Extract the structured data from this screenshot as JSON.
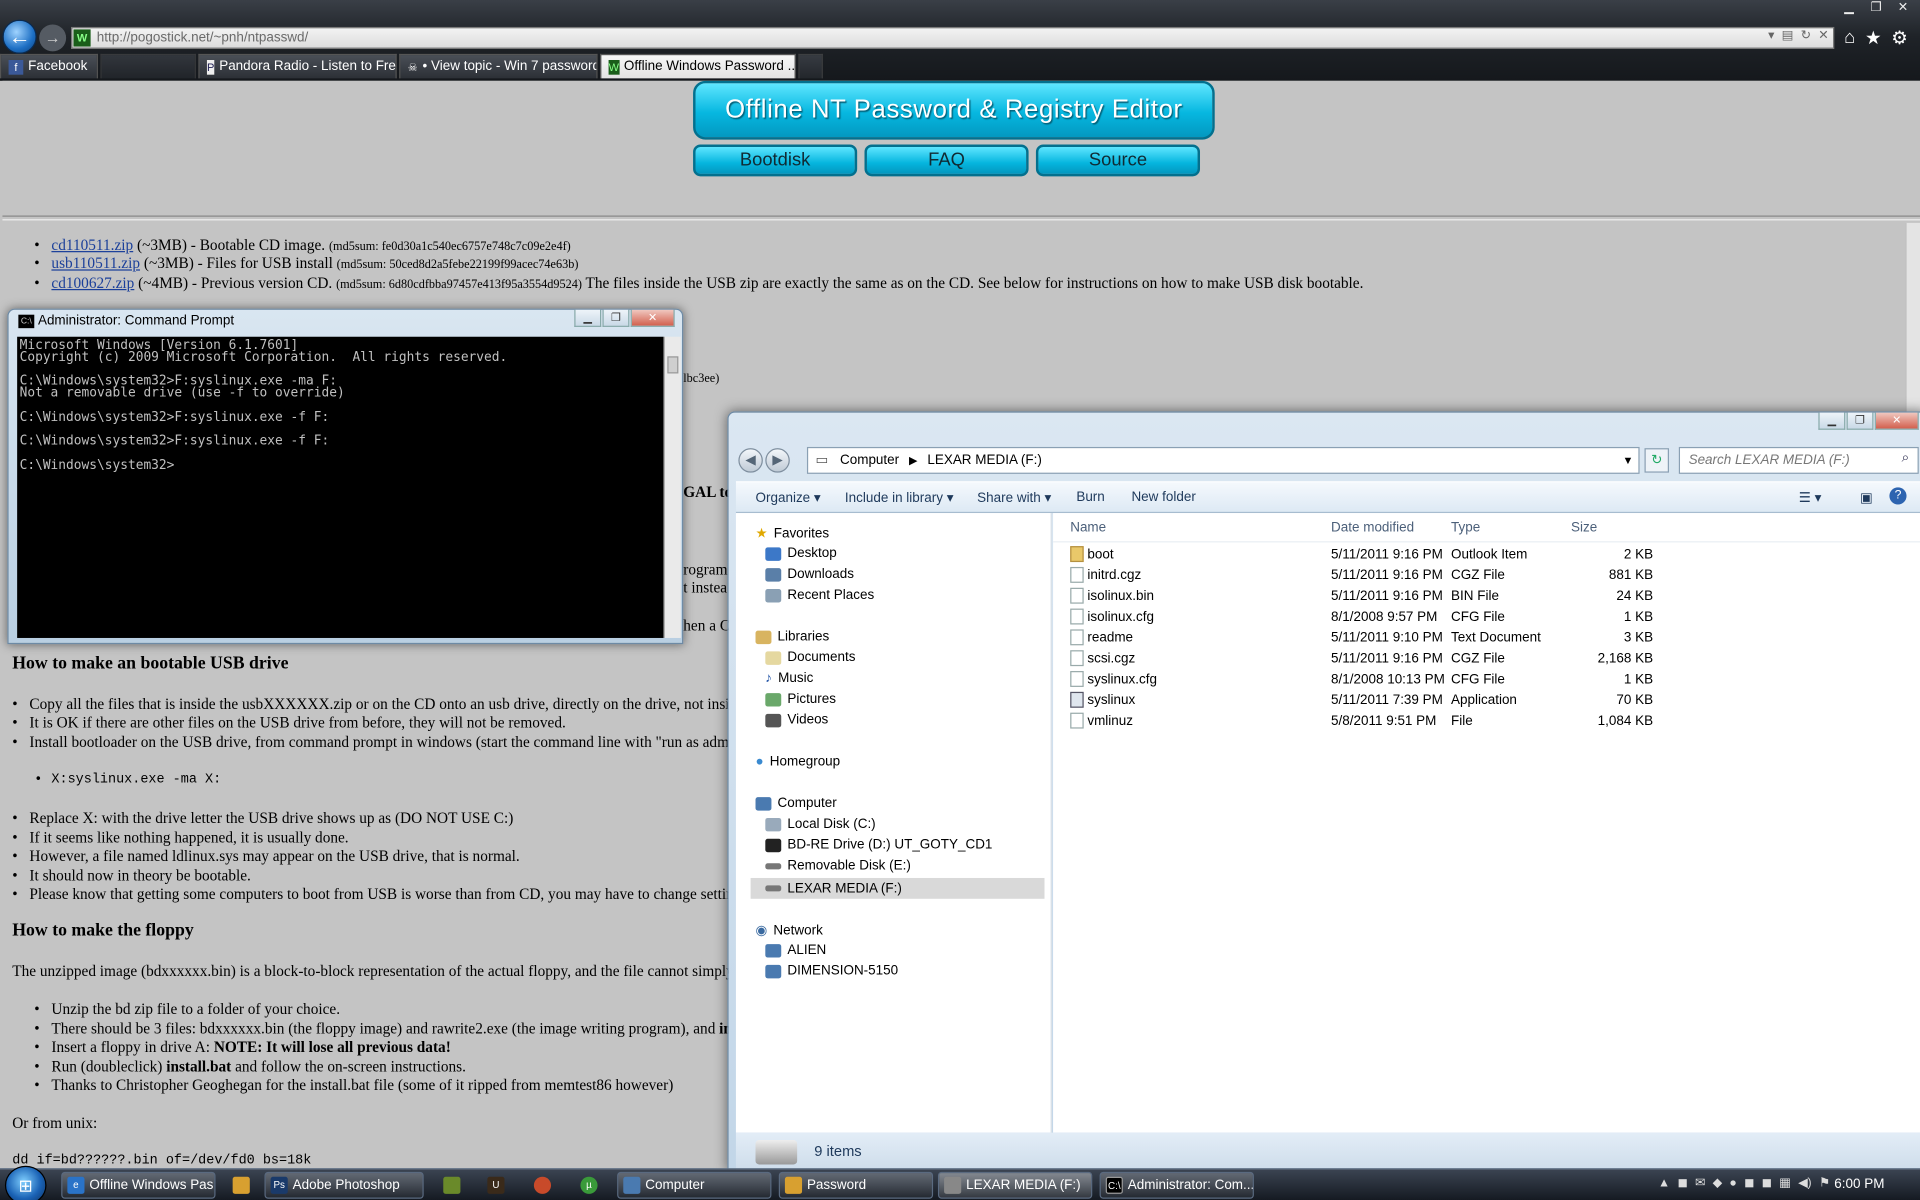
{
  "browser": {
    "url": "http://pogostick.net/~pnh/ntpasswd/",
    "tabs": [
      {
        "label": "Facebook"
      },
      {
        "label": "Pandora Radio - Listen to Free ..."
      },
      {
        "label": "• View topic - Win 7 password ..."
      },
      {
        "label": "Offline Windows Password ..."
      }
    ]
  },
  "site": {
    "banner": "Offline NT Password & Registry Editor",
    "nav": [
      "Bootdisk",
      "FAQ",
      "Source"
    ]
  },
  "downloads": [
    {
      "link": "cd110511.zip",
      "desc": " (~3MB) - Bootable CD image. ",
      "md5": "(md5sum: fe0d30a1c540ec6757e748c7c09e2e4f)",
      "extra": ""
    },
    {
      "link": "usb110511.zip",
      "desc": " (~3MB) - Files for USB install ",
      "md5": "(md5sum: 50ced8d2a5febe22199f99acec74e63b)",
      "extra": ""
    },
    {
      "link": "cd100627.zip",
      "desc": " (~4MB) - Previous version CD. ",
      "md5": "(md5sum: 6d80cdfbba97457e413f95a3554d9524)",
      "extra": " The files inside the USB zip are exactly the same as on the CD. See below for instructions on how to make USB disk bootable."
    }
  ],
  "peek": {
    "a": "lbc3ee)",
    "b": "GAL to",
    "c": "rogram",
    "d": "t instea",
    "e": "hen a C"
  },
  "usb_section": {
    "heading": "How to make an bootable USB drive",
    "items": [
      "Copy all the files that is inside the usbXXXXXX.zip or on the CD onto an usb drive, directly on the drive, not inside",
      "It is OK if there are other files on the USB drive from before, they will not be removed.",
      "Install bootloader on the USB drive, from command prompt in windows (start the command line with \"run as adminis"
    ],
    "code": "X:syslinux.exe -ma X:",
    "items2": [
      "Replace X: with the drive letter the USB drive shows up as (DO NOT USE C:)",
      "If it seems like nothing happened, it is usually done.",
      "However, a file named ldlinux.sys may appear on the USB drive, that is normal.",
      "It should now in theory be bootable.",
      "Please know that getting some computers to boot from USB is worse than from CD, you may have to change setting"
    ]
  },
  "floppy_section": {
    "heading": "How to make the floppy",
    "intro": "The unzipped image (bdxxxxxx.bin) is a block-to-block representation of the actual floppy, and the file cannot simply be",
    "i1": "Unzip the bd zip file to a folder of your choice.",
    "i2a": "There should be 3 files: bdxxxxxx.bin (the floppy image) and rawrite2.exe (the image writing program), and ",
    "i2b": "insta",
    "i3a": "Insert a floppy in drive A: ",
    "i3b": "NOTE: It will lose all previous data!",
    "i4a": "Run (doubleclick) ",
    "i4b": "install.bat",
    "i4c": " and follow the on-screen instructions.",
    "i5": "Thanks to Christopher Geoghegan for the install.bat file (some of it ripped from memtest86 however)",
    "unix": "Or from unix:",
    "dd": "dd if=bd??????.bin of=/dev/fd0 bs=18k"
  },
  "cmd": {
    "title": "Administrator: Command Prompt",
    "icon": "cmd-icon",
    "output": "Microsoft Windows [Version 6.1.7601]\nCopyright (c) 2009 Microsoft Corporation.  All rights reserved.\n\nC:\\Windows\\system32>F:syslinux.exe -ma F:\nNot a removable drive (use -f to override)\n\nC:\\Windows\\system32>F:syslinux.exe -f F:\n\nC:\\Windows\\system32>F:syslinux.exe -f F:\n\nC:\\Windows\\system32>"
  },
  "explorer": {
    "breadcrumb": [
      "Computer",
      "LEXAR MEDIA (F:)"
    ],
    "search_placeholder": "Search LEXAR MEDIA (F:)",
    "toolbar": [
      "Organize",
      "Include in library",
      "Share with",
      "Burn",
      "New folder"
    ],
    "nav": {
      "favorites": "Favorites",
      "desktop": "Desktop",
      "downloads": "Downloads",
      "recent": "Recent Places",
      "libraries": "Libraries",
      "documents": "Documents",
      "music": "Music",
      "pictures": "Pictures",
      "videos": "Videos",
      "homegroup": "Homegroup",
      "computer": "Computer",
      "local": "Local Disk (C:)",
      "bd": "BD-RE Drive (D:) UT_GOTY_CD1",
      "removable": "Removable Disk (E:)",
      "lexar": "LEXAR MEDIA (F:)",
      "network": "Network",
      "alien": "ALIEN",
      "dimension": "DIMENSION-5150"
    },
    "columns": [
      "Name",
      "Date modified",
      "Type",
      "Size"
    ],
    "files": [
      {
        "name": "boot",
        "date": "5/11/2011 9:16 PM",
        "type": "Outlook Item",
        "size": "2 KB"
      },
      {
        "name": "initrd.cgz",
        "date": "5/11/2011 9:16 PM",
        "type": "CGZ File",
        "size": "881 KB"
      },
      {
        "name": "isolinux.bin",
        "date": "5/11/2011 9:16 PM",
        "type": "BIN File",
        "size": "24 KB"
      },
      {
        "name": "isolinux.cfg",
        "date": "8/1/2008 9:57 PM",
        "type": "CFG File",
        "size": "1 KB"
      },
      {
        "name": "readme",
        "date": "5/11/2011 9:10 PM",
        "type": "Text Document",
        "size": "3 KB"
      },
      {
        "name": "scsi.cgz",
        "date": "5/11/2011 9:16 PM",
        "type": "CGZ File",
        "size": "2,168 KB"
      },
      {
        "name": "syslinux.cfg",
        "date": "8/1/2008 10:13 PM",
        "type": "CFG File",
        "size": "1 KB"
      },
      {
        "name": "syslinux",
        "date": "5/11/2011 7:39 PM",
        "type": "Application",
        "size": "70 KB"
      },
      {
        "name": "vmlinuz",
        "date": "5/8/2011 9:51 PM",
        "type": "File",
        "size": "1,084 KB"
      }
    ],
    "status": "9 items"
  },
  "taskbar": {
    "items": [
      "Offline Windows Pas...",
      "Adobe Photoshop",
      "Computer",
      "Password",
      "LEXAR MEDIA (F:)",
      "Administrator: Com..."
    ],
    "clock": "6:00 PM"
  }
}
